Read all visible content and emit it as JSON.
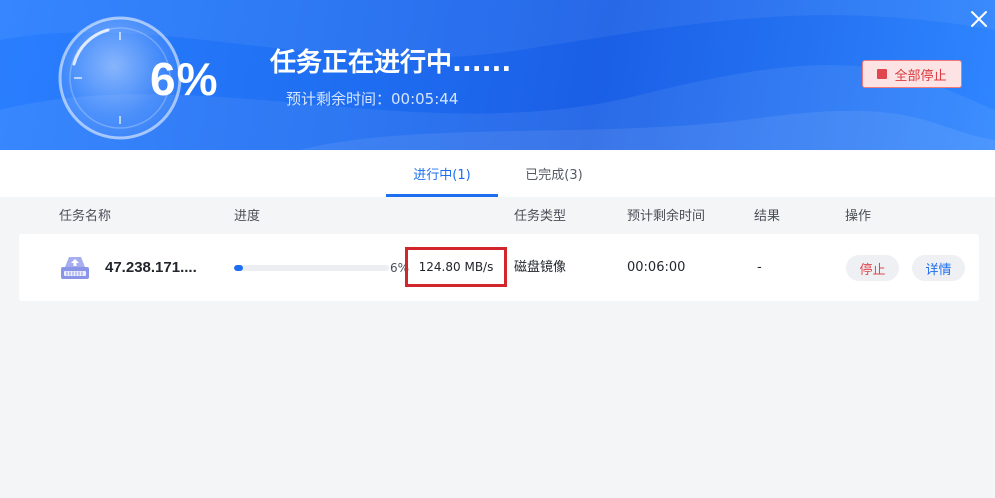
{
  "header": {
    "percent": "6%",
    "status_title": "任务正在进行中......",
    "eta": "预计剩余时间：00:05:44",
    "stop_all_label": "全部停止"
  },
  "tabs": [
    {
      "label": "进行中(1)",
      "active": true
    },
    {
      "label": "已完成(3)",
      "active": false
    }
  ],
  "table": {
    "columns": {
      "name": "任务名称",
      "progress": "进度",
      "type": "任务类型",
      "remaining": "预计剩余时间",
      "result": "结果",
      "actions": "操作"
    },
    "rows": [
      {
        "name": "47.238.171....",
        "progress_fraction": 0.06,
        "progress_label": "6%",
        "speed": "124.80 MB/s",
        "type": "磁盘镜像",
        "remaining": "00:06:00",
        "result": "-",
        "stop_label": "停止",
        "detail_label": "详情"
      }
    ]
  },
  "colors": {
    "accent": "#1e6ff0",
    "banner": "#1f6ef2",
    "danger": "#e0474c",
    "highlight_box": "#d3262c"
  },
  "icons": {
    "close": "close-icon",
    "stop": "stop-square-icon",
    "task": "disk-upload-icon",
    "clock": "clock-graphic-icon"
  }
}
